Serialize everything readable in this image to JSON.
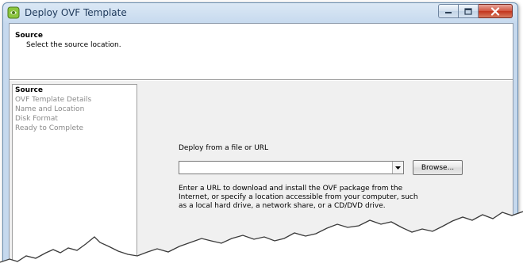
{
  "window": {
    "title": "Deploy OVF Template",
    "icon": "vsphere-app-icon",
    "controls": [
      "minimize-icon",
      "maximize-icon",
      "close-icon"
    ]
  },
  "header": {
    "title": "Source",
    "subtitle": "Select the source location."
  },
  "steps": [
    {
      "label": "Source",
      "active": true
    },
    {
      "label": "OVF Template Details",
      "active": false
    },
    {
      "label": "Name and Location",
      "active": false
    },
    {
      "label": "Disk Format",
      "active": false
    },
    {
      "label": "Ready to Complete",
      "active": false
    }
  ],
  "main": {
    "source_label": "Deploy from a file or URL",
    "source_value": "",
    "browse_label": "Browse...",
    "description": "Enter a URL to download and install the OVF package from the Internet, or specify a location accessible from your computer, such as a local hard drive, a network share, or a CD/DVD drive."
  },
  "colors": {
    "title_text": "#1e395b",
    "close_button": "#c2341c",
    "disabled_step": "#8a8a8a"
  }
}
